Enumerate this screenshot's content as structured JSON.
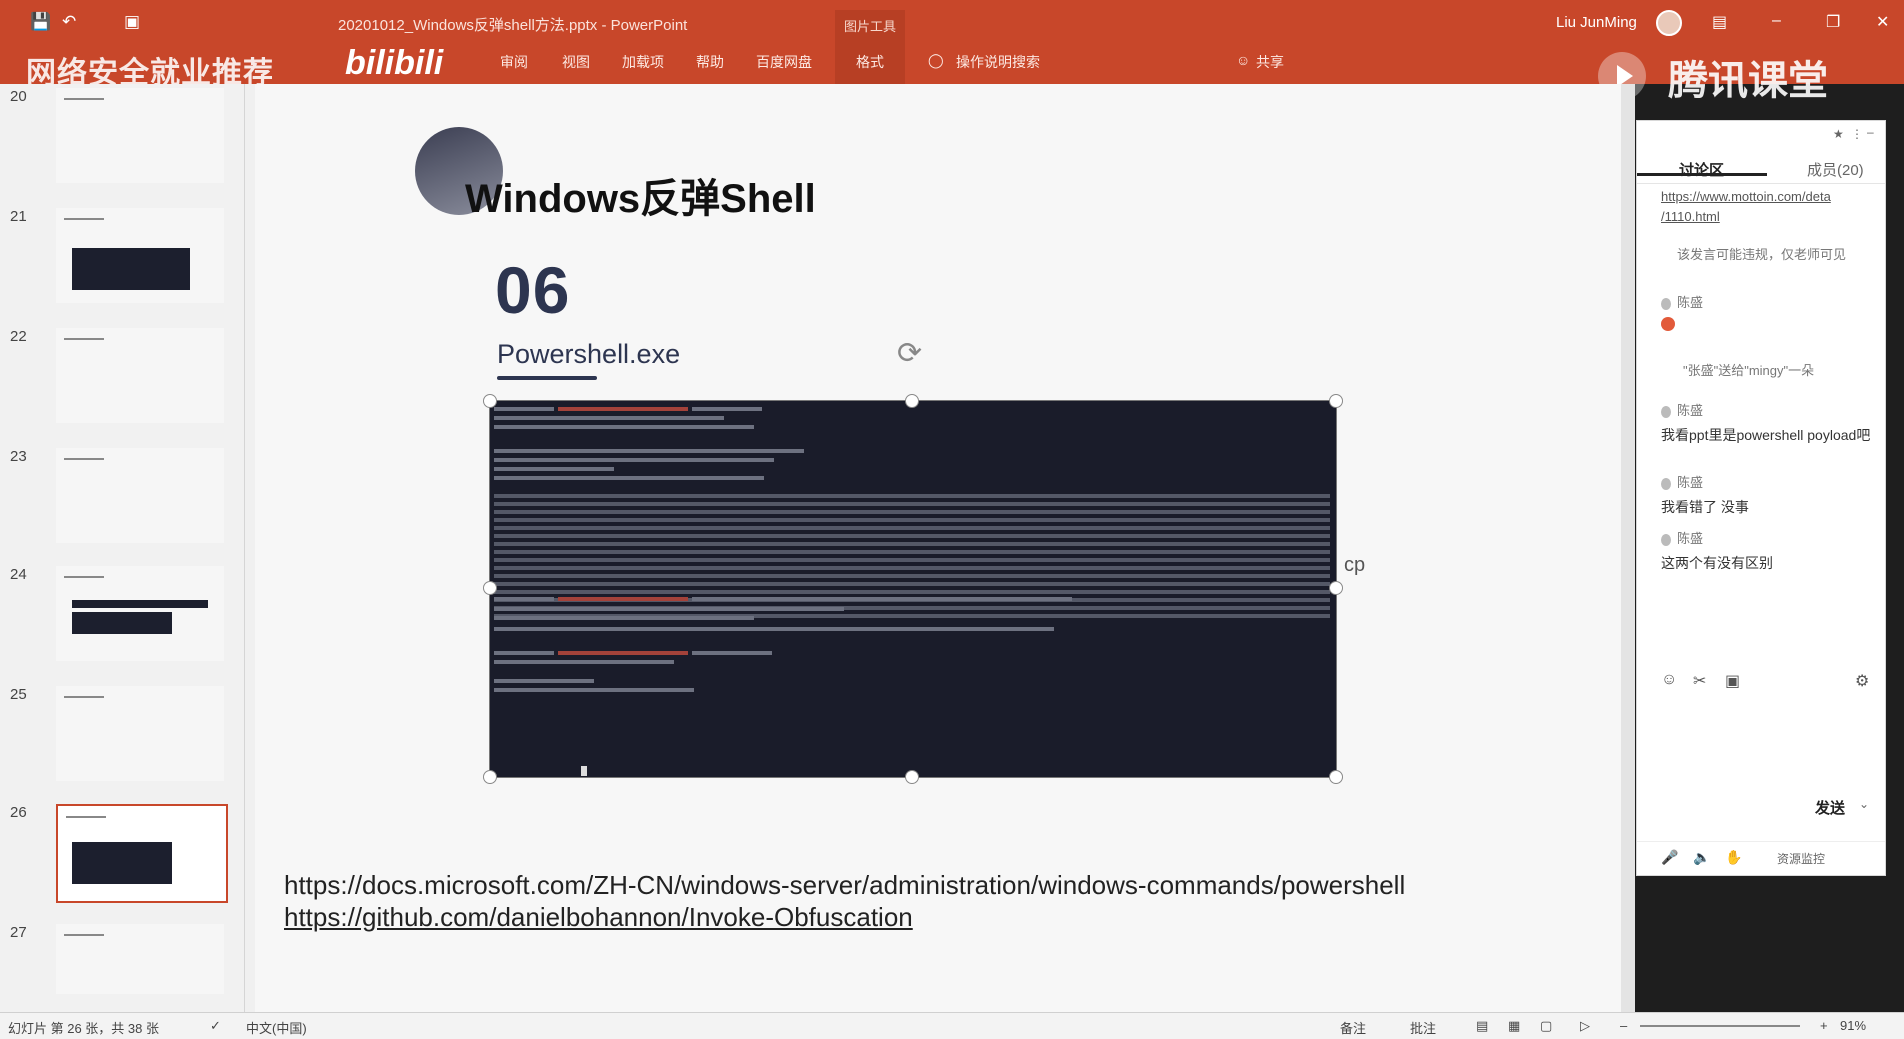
{
  "window": {
    "title": "20201012_Windows反弹shell方法.pptx - PowerPoint",
    "context_tab": "图片工具",
    "user": "Liu JunMing"
  },
  "ribbon": {
    "tabs": [
      "审阅",
      "视图",
      "加载项",
      "帮助",
      "百度网盘",
      "格式",
      "操作说明搜索"
    ],
    "share": "共享",
    "watermark_left": "网络安全就业推荐",
    "watermark_bili": "bilibili",
    "watermark_right": "腾讯课堂"
  },
  "thumbnails": [
    {
      "num": "20"
    },
    {
      "num": "21"
    },
    {
      "num": "22"
    },
    {
      "num": "23"
    },
    {
      "num": "24"
    },
    {
      "num": "25"
    },
    {
      "num": "26"
    },
    {
      "num": "27"
    }
  ],
  "slide": {
    "title": "Windows反弹Shell",
    "number": "06",
    "subtitle": "Powershell.exe",
    "side_text": "cp",
    "link1": "https://docs.microsoft.com/ZH-CN/windows-server/administration/windows-commands/powershell",
    "link2": "https://github.com/danielbohannon/Invoke-Obfuscation"
  },
  "chat": {
    "tab_discussion": "讨论区",
    "tab_members": "成员(20)",
    "messages": [
      {
        "type": "link",
        "text": "https://www.mottoin.com/deta",
        "text2": "/1110.html"
      },
      {
        "type": "sys",
        "text": "该发言可能违规，仅老师可见"
      },
      {
        "type": "name",
        "text": "陈盛"
      },
      {
        "type": "name",
        "text": "\"张盛\"送给\"mingy\"一朵"
      },
      {
        "type": "name",
        "text": "陈盛"
      },
      {
        "type": "text",
        "text": "我看ppt里是powershell poyload吧"
      },
      {
        "type": "name",
        "text": "陈盛"
      },
      {
        "type": "text",
        "text": "我看错了 没事"
      },
      {
        "type": "name",
        "text": "陈盛"
      },
      {
        "type": "text",
        "text": "这两个有没有区别"
      }
    ],
    "send_label": "发送",
    "bottom_label": "资源监控"
  },
  "status": {
    "slide_info": "幻灯片 第 26 张，共 38 张",
    "language": "中文(中国)",
    "notes": "备注",
    "comments": "批注",
    "zoom": "91%"
  }
}
